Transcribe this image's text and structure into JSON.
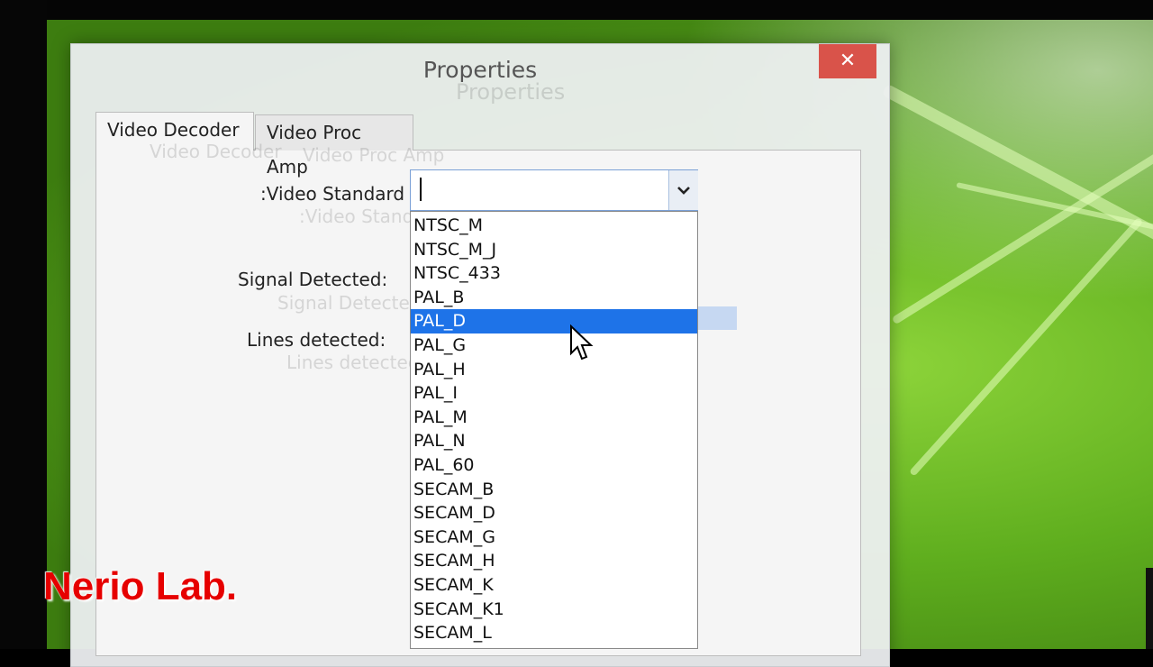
{
  "dialog": {
    "title": "Properties",
    "close_label": "✕",
    "tabs": [
      {
        "label": "Video Decoder",
        "active": true
      },
      {
        "label": "Video Proc Amp",
        "active": false
      }
    ],
    "fields": {
      "video_standard_label": ":Video Standard",
      "signal_detected_label": "Signal Detected:",
      "lines_detected_label": "Lines detected:"
    },
    "video_standard": {
      "value": "",
      "selected": "PAL_D",
      "options": [
        "NTSC_M",
        "NTSC_M_J",
        "NTSC_433",
        "PAL_B",
        "PAL_D",
        "PAL_G",
        "PAL_H",
        "PAL_I",
        "PAL_M",
        "PAL_N",
        "PAL_60",
        "SECAM_B",
        "SECAM_D",
        "SECAM_G",
        "SECAM_H",
        "SECAM_K",
        "SECAM_K1",
        "SECAM_L"
      ]
    }
  },
  "watermark": "Nerio Lab.",
  "icons": {
    "close": "close-icon",
    "dropdown": "chevron-down-icon",
    "cursor": "mouse-pointer-icon"
  },
  "colors": {
    "close_button": "#d9534a",
    "selection": "#1e73e8",
    "watermark": "#e60000",
    "leaf": "#5fae1e"
  }
}
